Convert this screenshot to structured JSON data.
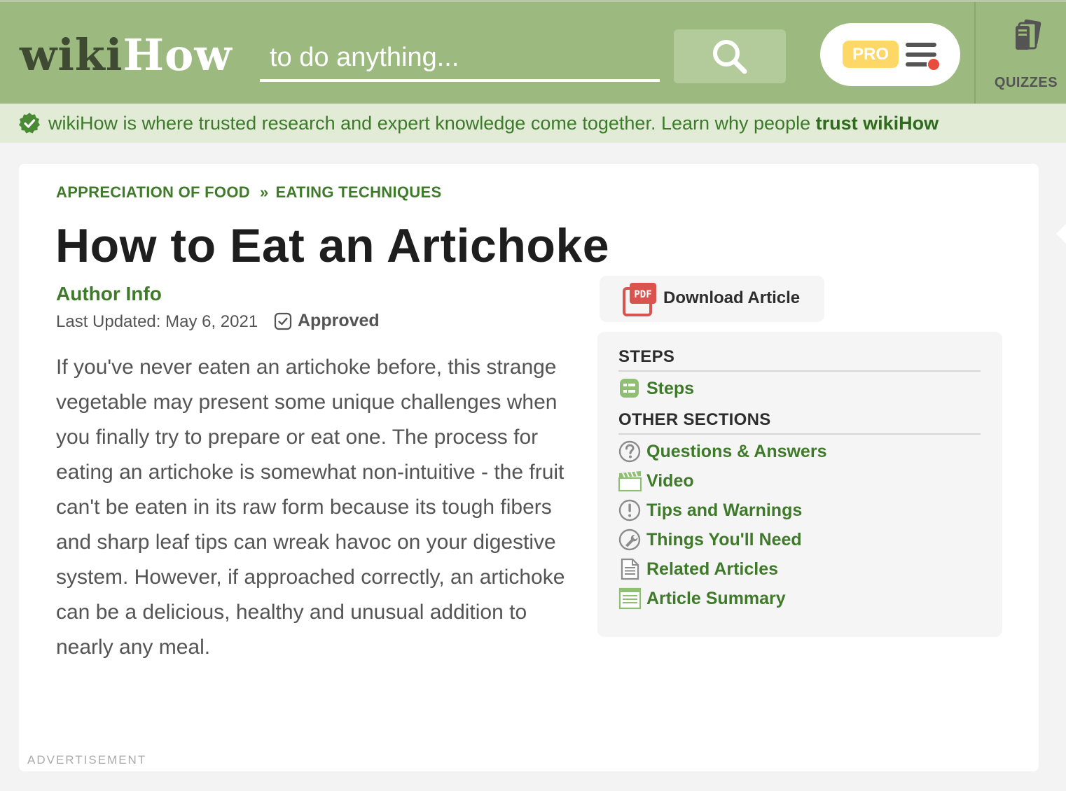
{
  "header": {
    "logo_wiki": "wiki",
    "logo_how": "How",
    "search_placeholder": "to do anything...",
    "pro_label": "PRO",
    "quizzes_label": "QUIZZES"
  },
  "trust_bar": {
    "text": "wikiHow is where trusted research and expert knowledge come together. Learn why people ",
    "link": "trust wikiHow"
  },
  "article": {
    "breadcrumb": [
      "APPRECIATION OF FOOD",
      "EATING TECHNIQUES"
    ],
    "breadcrumb_sep": "»",
    "title": "How to Eat an Artichoke",
    "author_info": "Author Info",
    "last_updated": "Last Updated: May 6, 2021",
    "approved": "Approved",
    "intro": "If you've never eaten an artichoke before, this strange vegetable may present some unique challenges when you finally try to prepare or eat one. The process for eating an artichoke is somewhat non-intuitive - the fruit can't be eaten in its raw form because its tough fibers and sharp leaf tips can wreak havoc on your digestive system. However, if approached correctly, an artichoke can be a delicious, healthy and unusual addition to nearly any meal.",
    "advertisement": "ADVERTISEMENT"
  },
  "download": {
    "label": "Download Article",
    "icon_text": "PDF"
  },
  "toc": {
    "steps_heading": "STEPS",
    "steps_items": [
      {
        "label": "Steps",
        "icon": "steps-icon"
      }
    ],
    "other_heading": "OTHER SECTIONS",
    "other_items": [
      {
        "label": "Questions & Answers",
        "icon": "question-icon"
      },
      {
        "label": "Video",
        "icon": "video-icon"
      },
      {
        "label": "Tips and Warnings",
        "icon": "warning-icon"
      },
      {
        "label": "Things You'll Need",
        "icon": "wrench-icon"
      },
      {
        "label": "Related Articles",
        "icon": "document-icon"
      },
      {
        "label": "Article Summary",
        "icon": "summary-icon"
      }
    ]
  },
  "colors": {
    "header_green": "#9cba7f",
    "link_green": "#3f7a2a",
    "trust_bar": "#e1ebd6",
    "pro_yellow": "#fdd866",
    "notification_red": "#e84c3d",
    "pdf_red": "#d9534f"
  }
}
